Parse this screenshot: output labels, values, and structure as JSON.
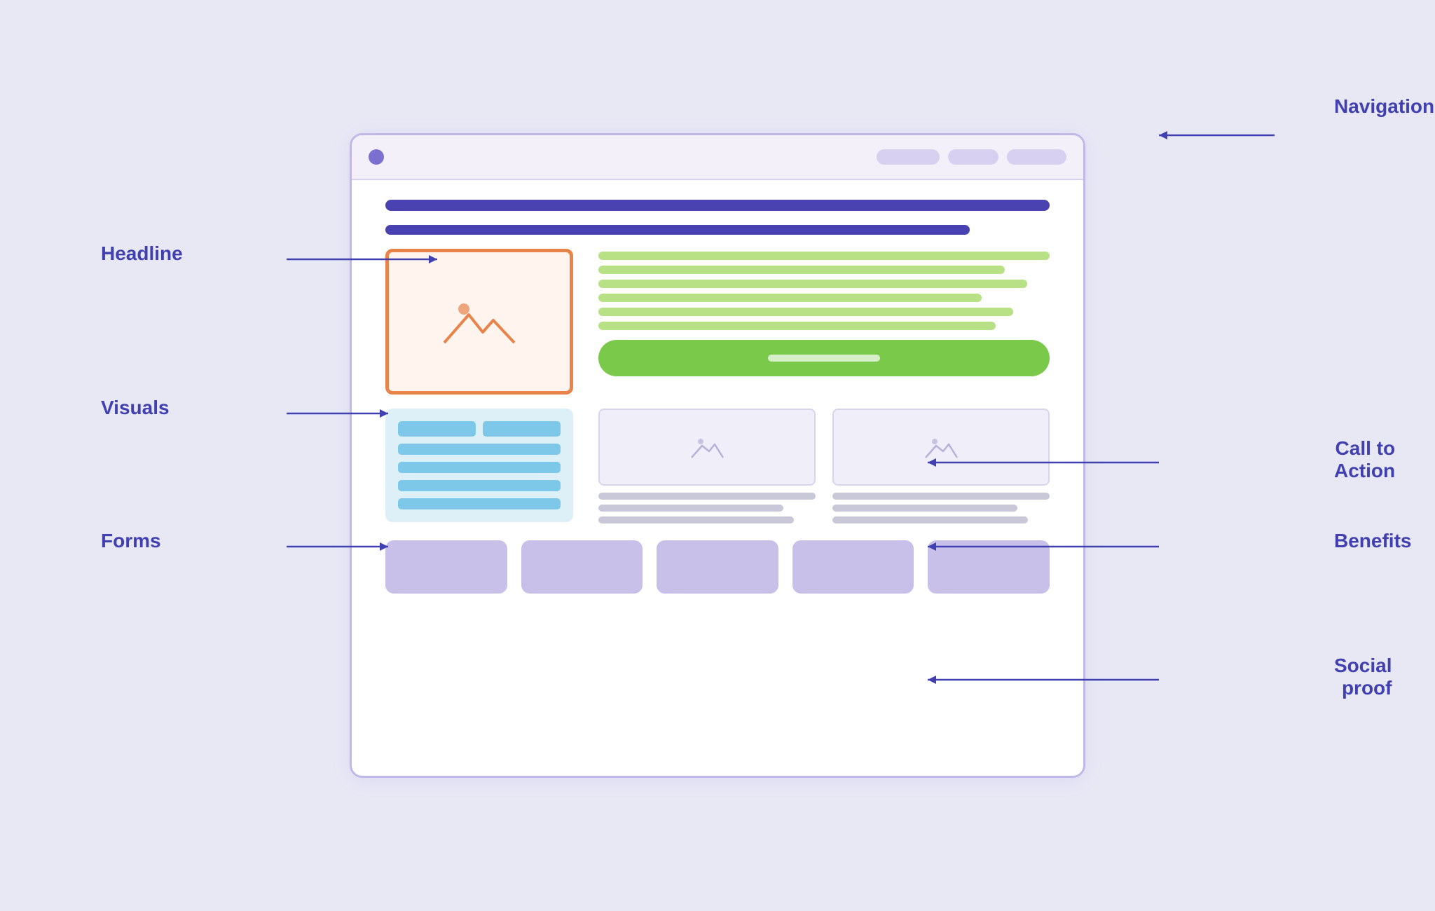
{
  "labels": {
    "navigation": "Navigation",
    "headline": "Headline",
    "visuals": "Visuals",
    "forms": "Forms",
    "call_to_action": "Call to\nAction",
    "benefits": "Benefits",
    "social_proof": "Social\nproof"
  },
  "browser": {
    "dot_color": "#7b6fcf",
    "nav_pills": [
      "",
      "",
      ""
    ]
  },
  "colors": {
    "background": "#e8e8f5",
    "headline": "#4a42b0",
    "cta": "#7ac94a",
    "image_border": "#e8834a",
    "green_lines": "#b8e084",
    "form_bg": "#ddf0f8",
    "form_inputs": "#7dc8e8",
    "benefit_bg": "#f0eef8",
    "gray_lines": "#c8c8d8",
    "social_cards": "#c8c0e8",
    "annotation": "#4040b0"
  }
}
